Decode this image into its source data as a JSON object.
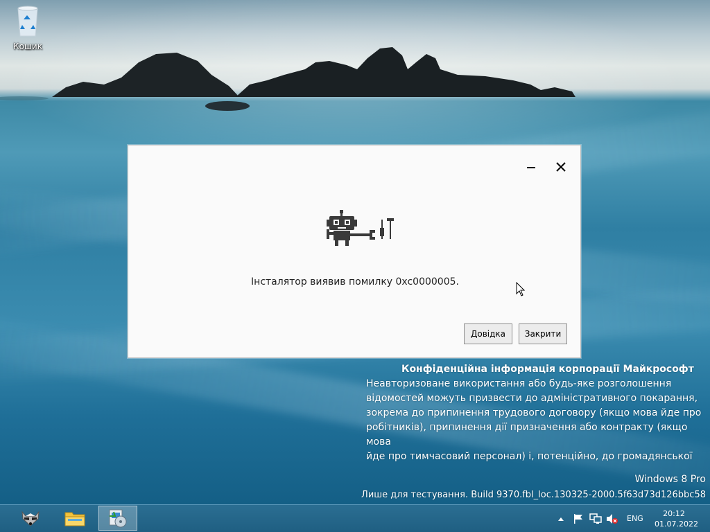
{
  "desktop": {
    "recycle_bin_label": "Кошик",
    "icons": {
      "recycle_bin": "recycle-bin-icon"
    }
  },
  "dialog": {
    "message": "Інсталятор виявив помилку 0xc0000005.",
    "help_button": "Довідка",
    "close_button": "Закрити",
    "icons": {
      "minimize": "minimize-icon",
      "close": "close-icon",
      "illustration": "robot-with-tools-icon"
    }
  },
  "watermark": {
    "confidential_title": "Конфіденційна інформація корпорації Майкрософт",
    "confidential_lines": [
      "Неавторизоване використання або будь-яке розголошення",
      "відомостей можуть призвести до адміністративного покарання,",
      "зокрема до припинення трудового договору (якщо мова йде про",
      "робітників), припинення дії призначення або контракту (якщо мова",
      "йде про тимчасовий персонал) і, потенційно, до громадянської"
    ],
    "edition": "Windows 8 Pro",
    "build": "Лише для тестування. Build 9370.fbl_loc.130325-2000.5f63d73d126bbc58"
  },
  "taskbar": {
    "items": [
      "raccoon-app-icon",
      "file-explorer-icon",
      "setup-installer-icon"
    ],
    "tray": {
      "language": "ENG",
      "time": "20:12",
      "date": "01.07.2022",
      "icons": [
        "show-hidden-icons-chevron",
        "action-center-flag-icon",
        "network-icon",
        "speaker-muted-icon"
      ]
    }
  },
  "colors": {
    "taskbar": "#23678b",
    "dialog_bg": "#fafafa",
    "text_white": "#ffffff"
  }
}
